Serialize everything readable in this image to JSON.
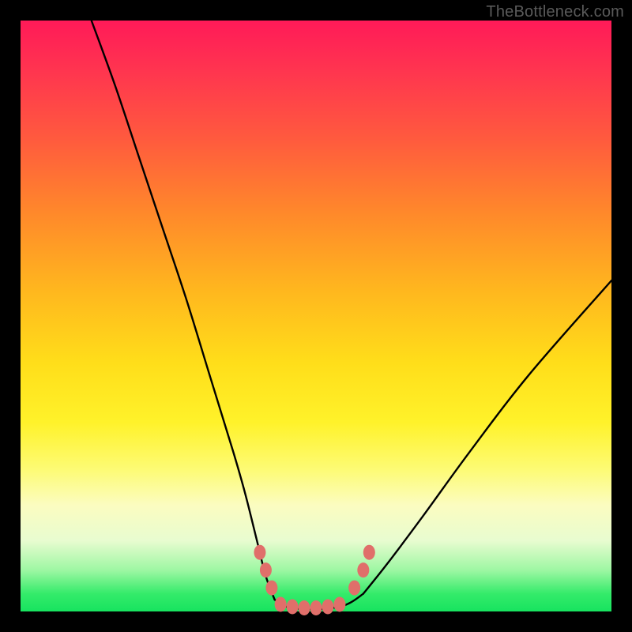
{
  "watermark": "TheBottleneck.com",
  "chart_data": {
    "type": "line",
    "title": "",
    "xlabel": "",
    "ylabel": "",
    "xlim": [
      0,
      100
    ],
    "ylim": [
      0,
      100
    ],
    "series": [
      {
        "name": "left-branch",
        "x": [
          12,
          16,
          20,
          24,
          28,
          32,
          36,
          38,
          40,
          41.5,
          43
        ],
        "y": [
          100,
          89,
          77,
          65,
          53,
          40,
          27,
          20,
          12,
          6,
          2
        ]
      },
      {
        "name": "valley-floor",
        "x": [
          43,
          45,
          48,
          51,
          54,
          56,
          58
        ],
        "y": [
          2,
          0.8,
          0.4,
          0.4,
          0.8,
          1.6,
          3
        ]
      },
      {
        "name": "right-branch",
        "x": [
          58,
          62,
          68,
          76,
          86,
          100
        ],
        "y": [
          3,
          8,
          16,
          27,
          40,
          56
        ]
      }
    ],
    "markers": {
      "name": "salmon-dots",
      "color": "#e06f6a",
      "points": [
        {
          "x": 40.5,
          "y": 10
        },
        {
          "x": 41.5,
          "y": 7
        },
        {
          "x": 42.5,
          "y": 4
        },
        {
          "x": 44,
          "y": 1.2
        },
        {
          "x": 46,
          "y": 0.8
        },
        {
          "x": 48,
          "y": 0.6
        },
        {
          "x": 50,
          "y": 0.6
        },
        {
          "x": 52,
          "y": 0.8
        },
        {
          "x": 54,
          "y": 1.2
        },
        {
          "x": 56.5,
          "y": 4
        },
        {
          "x": 58,
          "y": 7
        },
        {
          "x": 59,
          "y": 10
        }
      ]
    },
    "gradient_stops": [
      {
        "pos": 0,
        "color": "#ff1a58"
      },
      {
        "pos": 20,
        "color": "#ff5a3e"
      },
      {
        "pos": 46,
        "color": "#ffb81e"
      },
      {
        "pos": 68,
        "color": "#fff22a"
      },
      {
        "pos": 88,
        "color": "#e8fcd0"
      },
      {
        "pos": 100,
        "color": "#17e35f"
      }
    ]
  }
}
